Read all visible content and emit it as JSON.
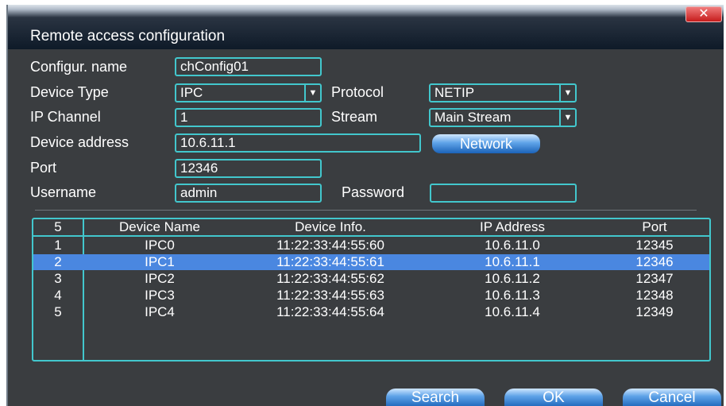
{
  "window": {
    "title": "Remote access configuration",
    "close_glyph": "✕"
  },
  "form": {
    "config_name_label": "Configur. name",
    "config_name_value": "chConfig01",
    "device_type_label": "Device Type",
    "device_type_value": "IPC",
    "protocol_label": "Protocol",
    "protocol_value": "NETIP",
    "ip_channel_label": "IP Channel",
    "ip_channel_value": "1",
    "stream_label": "Stream",
    "stream_value": "Main Stream",
    "device_address_label": "Device address",
    "device_address_value": "10.6.11.1",
    "network_button": "Network",
    "port_label": "Port",
    "port_value": "12346",
    "username_label": "Username",
    "username_value": "admin",
    "password_label": "Password",
    "password_value": ""
  },
  "table": {
    "headers": [
      "5",
      "Device Name",
      "Device Info.",
      "IP Address",
      "Port"
    ],
    "selected_index": 1,
    "rows": [
      [
        "1",
        "IPC0",
        "11:22:33:44:55:60",
        "10.6.11.0",
        "12345"
      ],
      [
        "2",
        "IPC1",
        "11:22:33:44:55:61",
        "10.6.11.1",
        "12346"
      ],
      [
        "3",
        "IPC2",
        "11:22:33:44:55:62",
        "10.6.11.2",
        "12347"
      ],
      [
        "4",
        "IPC3",
        "11:22:33:44:55:63",
        "10.6.11.3",
        "12348"
      ],
      [
        "5",
        "IPC4",
        "11:22:33:44:55:64",
        "10.6.11.4",
        "12349"
      ]
    ]
  },
  "buttons": {
    "search": "Search",
    "ok": "OK",
    "cancel": "Cancel"
  },
  "icons": {
    "dropdown": "chevron-down-icon",
    "close": "close-icon"
  },
  "colors": {
    "accent_border": "#42c7cd",
    "selected_row": "#4a87e0",
    "button_blue": "#1b63b8",
    "close_red": "#c61c1c"
  }
}
